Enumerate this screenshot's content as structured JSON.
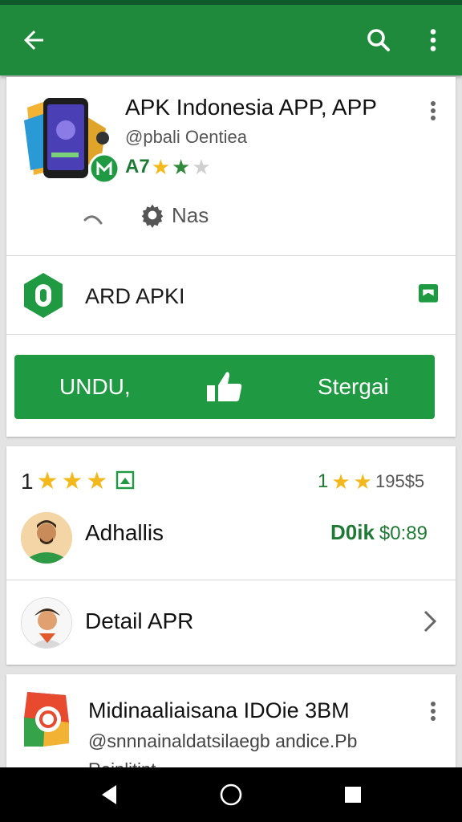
{
  "app": {
    "title": "APK Indonesia APP, APP",
    "developer": "@pbali Oentiea",
    "rating_text": "A7",
    "rating_stars": 3,
    "rating_max": 4,
    "stat_label": "Nas"
  },
  "publisher": {
    "label": "ARD APKI"
  },
  "actions": {
    "install_label": "UNDU,",
    "open_label": "Stergai"
  },
  "review": {
    "left_count": "1",
    "left_stars": 3,
    "right_count": "1",
    "right_value": "195$5",
    "author": "Adhallis",
    "tag": "D0ik",
    "price": "$0:89"
  },
  "detail": {
    "label": "Detail APR"
  },
  "related": {
    "title": "Midinaaliaisana IDOie 3BM",
    "subtitle": "@snnnainaldatsilaegb andice.Pb",
    "cut_text": "Reinlitint"
  },
  "colors": {
    "brand_green": "#1f8a3c",
    "button_green": "#1f9a43",
    "star_yellow": "#f3b81b",
    "text_green": "#1e7a34"
  },
  "icons": {
    "back": "arrow-left-icon",
    "search": "search-icon",
    "more": "more-vert-icon"
  }
}
